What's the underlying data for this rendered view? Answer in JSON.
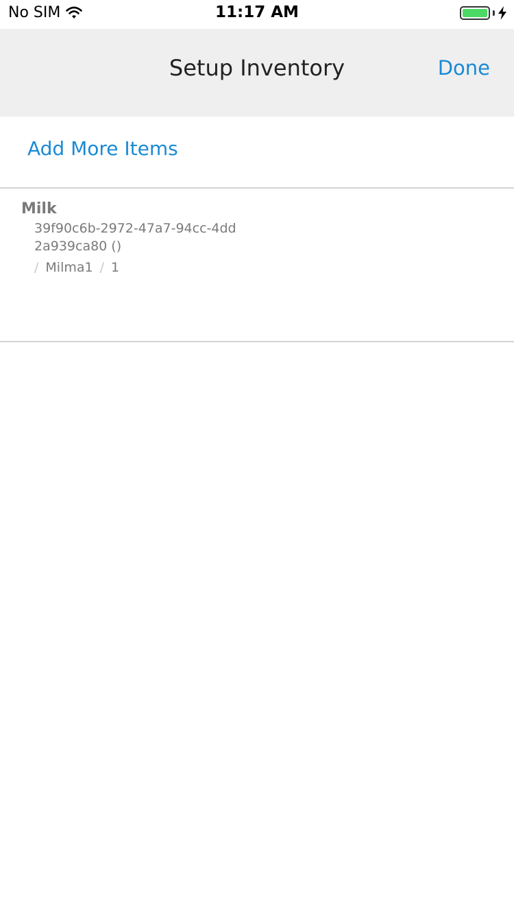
{
  "status_bar": {
    "carrier": "No SIM",
    "time": "11:17 AM",
    "wifi_icon": "wifi-icon",
    "battery_icon": "battery-icon",
    "charging_icon": "bolt-icon",
    "battery_color": "#4cd964",
    "battery_level": 1.0
  },
  "nav": {
    "title": "Setup Inventory",
    "done_label": "Done"
  },
  "actions": {
    "add_more_label": "Add More Items"
  },
  "items": [
    {
      "name": "Milk",
      "id": "39f90c6b-2972-47a7-94cc-4dd2a939ca80 ()",
      "separator": "/",
      "brand": "Milma1",
      "quantity": "1"
    }
  ],
  "colors": {
    "accent": "#1a8ad4",
    "nav_background": "#efefef",
    "muted_text": "#7a7a7a"
  }
}
